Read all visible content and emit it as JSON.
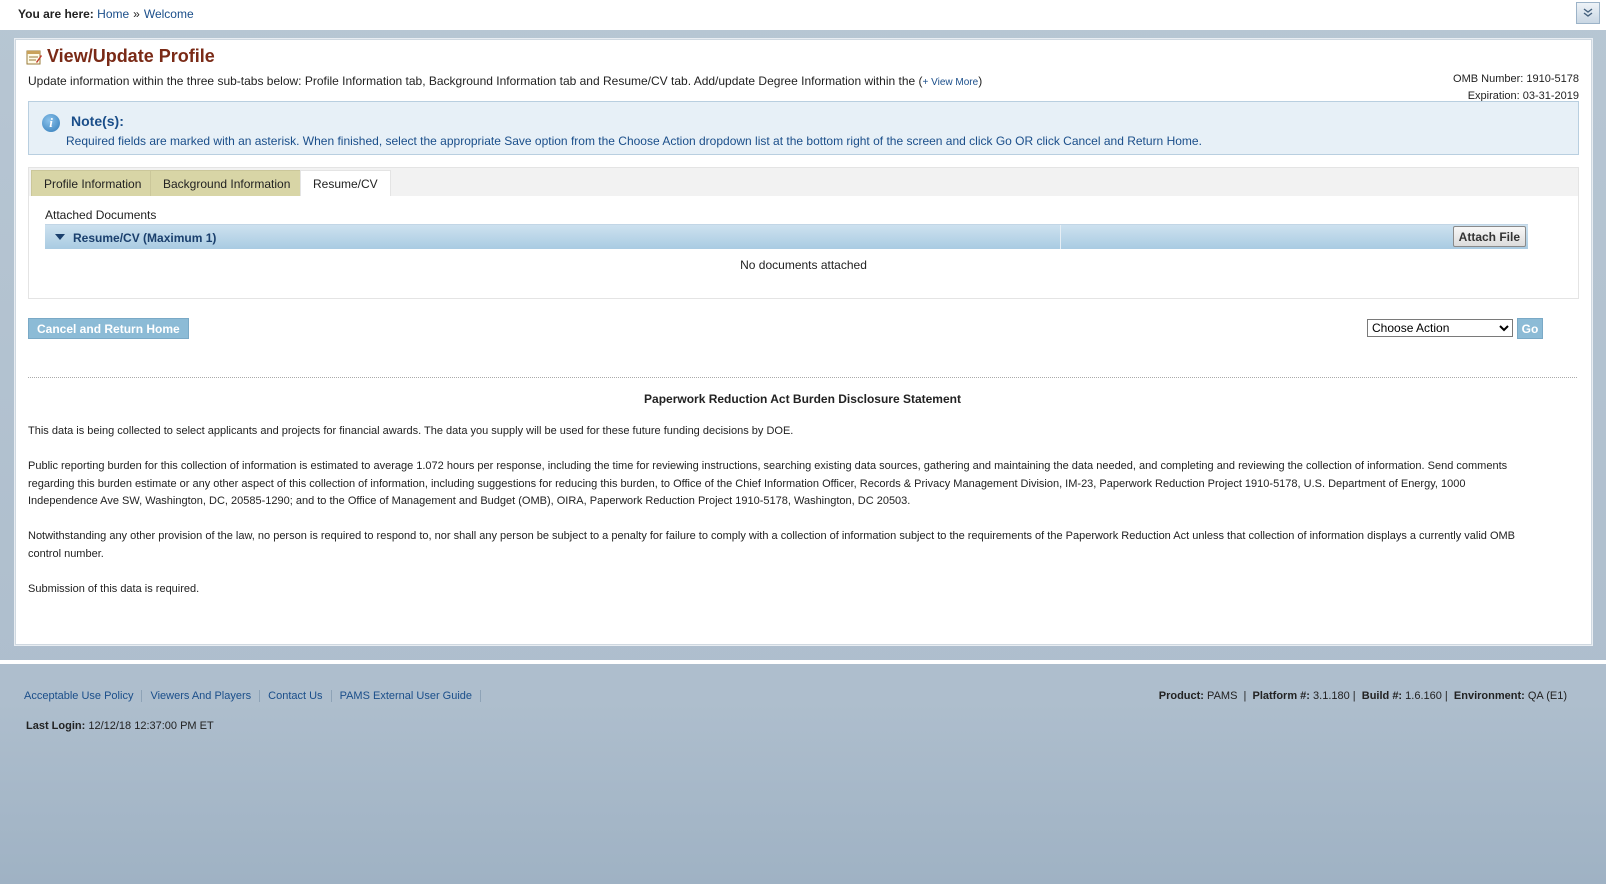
{
  "breadcrumb": {
    "prefix": "You are here:",
    "items": [
      "Home",
      "Welcome"
    ],
    "separator": "»"
  },
  "page": {
    "title": "View/Update Profile",
    "intro": "Update information within the three sub-tabs below: Profile Information tab, Background Information tab and Resume/CV tab. Add/update Degree Information within the (",
    "view_more": "+ View More",
    "intro_close": ")",
    "omb_number": "OMB Number: 1910-5178",
    "expiration": "Expiration: 03-31-2019"
  },
  "note": {
    "title": "Note(s):",
    "text": "Required fields are marked with an asterisk. When finished, select the appropriate Save option from the Choose Action dropdown list at the bottom right of the screen and click Go OR click Cancel and Return Home."
  },
  "tabs": [
    {
      "label": "Profile Information"
    },
    {
      "label": "Background Information"
    },
    {
      "label": "Resume/CV"
    }
  ],
  "documents": {
    "label": "Attached Documents",
    "section_title": "Resume/CV (Maximum 1)",
    "attach_button": "Attach File",
    "empty_text": "No documents attached"
  },
  "actions": {
    "cancel_button": "Cancel and Return Home",
    "select_value": "Choose Action",
    "go_button": "Go"
  },
  "pra": {
    "title": "Paperwork Reduction Act Burden Disclosure Statement",
    "p1": "This data is being collected to select applicants and projects for financial awards. The data you supply will be used for these future funding decisions by DOE.",
    "p2": "Public reporting burden for this collection of information is estimated to average 1.072 hours per response, including the time for reviewing instructions, searching existing data sources, gathering and maintaining the data needed, and completing and reviewing the collection of information. Send comments regarding this burden estimate or any other aspect of this collection of information, including suggestions for reducing this burden, to Office of the Chief Information Officer, Records & Privacy Management Division, IM-23, Paperwork Reduction Project 1910-5178, U.S. Department of Energy, 1000 Independence Ave SW, Washington, DC, 20585-1290; and to the Office of Management and Budget (OMB), OIRA, Paperwork Reduction Project 1910-5178, Washington, DC 20503.",
    "p3": "Notwithstanding any other provision of the law, no person is required to respond to, nor shall any person be subject to a penalty for failure to comply with a collection of information subject to the requirements of the Paperwork Reduction Act unless that collection of information displays a currently valid OMB control number.",
    "p4": "Submission of this data is required."
  },
  "footer": {
    "links": [
      "Acceptable Use Policy",
      "Viewers And Players",
      "Contact Us",
      "PAMS External User Guide"
    ],
    "product_label": "Product:",
    "product": "PAMS",
    "platform_label": "Platform #:",
    "platform": "3.1.180",
    "build_label": "Build #:",
    "build": "1.6.160",
    "environment_label": "Environment:",
    "environment": "QA (E1)",
    "last_login_label": "Last Login:",
    "last_login": "12/12/18 12:37:00 PM ET"
  },
  "colors": {
    "title": "#7a2a16",
    "link": "#1a4e8a",
    "tab": "#d8d5a6",
    "button": "#8cbbd6"
  },
  "icons": {
    "collapse": "chevron-double-down-icon",
    "page": "notepad-icon",
    "info": "info-icon",
    "toggle": "triangle-down-icon"
  }
}
